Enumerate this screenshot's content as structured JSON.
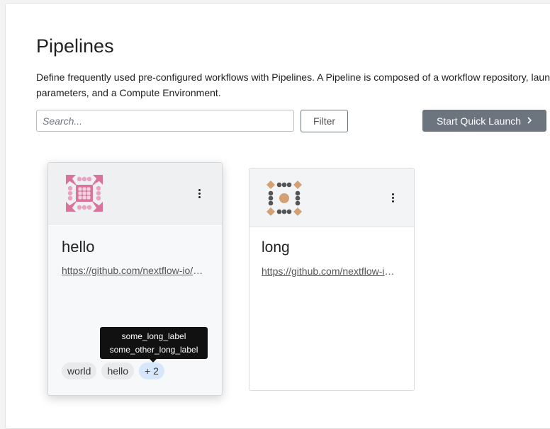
{
  "page": {
    "title": "Pipelines",
    "description": "Define frequently used pre-configured workflows with Pipelines. A Pipeline is composed of a workflow repository, launch parameters, and a Compute Environment."
  },
  "toolbar": {
    "search_placeholder": "Search...",
    "filter_label": "Filter",
    "quick_launch_label": "Start Quick Launch",
    "quick_launch_icon": "chevron-right-icon"
  },
  "pipelines": [
    {
      "name": "hello",
      "url": "https://github.com/nextflow-io/hello",
      "labels": [
        "world",
        "hello"
      ],
      "more_label": "+ 2",
      "avatar_color": "#d9739b",
      "tooltip": [
        "some_long_label",
        "some_other_long_label"
      ]
    },
    {
      "name": "long",
      "url": "https://github.com/nextflow-io/long",
      "labels": [],
      "avatar_colors": [
        "#d4a074",
        "#555555"
      ]
    }
  ],
  "colors": {
    "primary_button": "#6c757d",
    "label_bg": "#e9eaeb",
    "more_label_bg": "#d6e6fb"
  }
}
